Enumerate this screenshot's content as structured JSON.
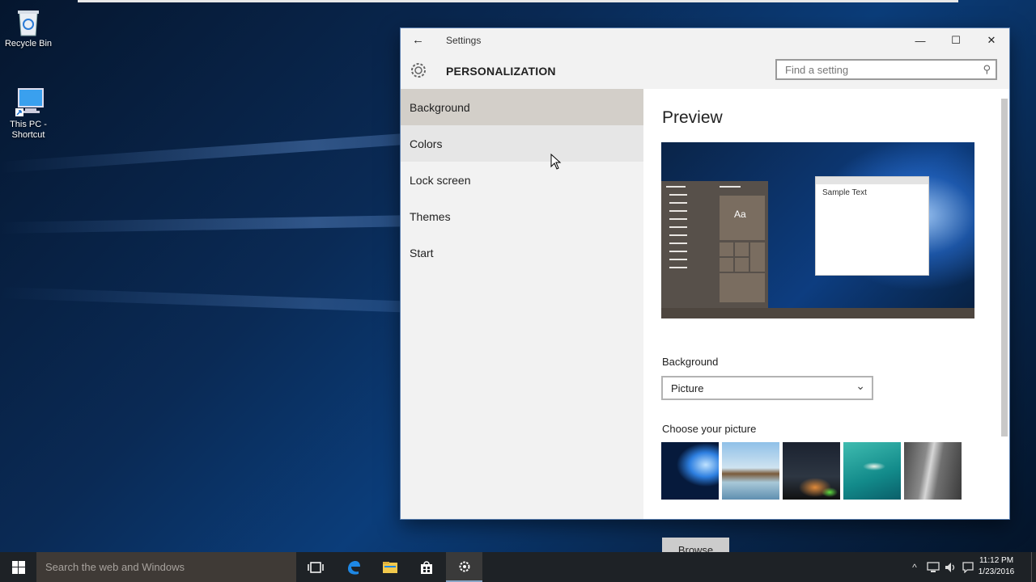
{
  "desktop": {
    "icons": [
      {
        "label_line1": "Recycle Bin",
        "label_line2": "",
        "icon": "recycle-bin-icon"
      },
      {
        "label_line1": "This PC -",
        "label_line2": "Shortcut",
        "icon": "computer-icon"
      }
    ]
  },
  "window": {
    "title": "Settings",
    "back_glyph": "←",
    "minimize_glyph": "—",
    "maximize_glyph": "☐",
    "close_glyph": "✕",
    "page_title": "PERSONALIZATION",
    "search_placeholder": "Find a setting",
    "search_icon_glyph": "⚲",
    "nav": [
      {
        "label": "Background",
        "state": "selected"
      },
      {
        "label": "Colors",
        "state": "hover"
      },
      {
        "label": "Lock screen",
        "state": "normal"
      },
      {
        "label": "Themes",
        "state": "normal"
      },
      {
        "label": "Start",
        "state": "normal"
      }
    ],
    "content": {
      "preview_heading": "Preview",
      "preview_tile_text": "Aa",
      "preview_sample_text": "Sample Text",
      "background_label": "Background",
      "background_value": "Picture",
      "dropdown_chevron": "⌄",
      "choose_label": "Choose your picture",
      "browse_label": "Browse",
      "pictures": [
        "windows-hero",
        "beach-rocks",
        "night-sky",
        "underwater-swimmer",
        "rock-cliff"
      ]
    }
  },
  "taskbar": {
    "search_placeholder": "Search the web and Windows",
    "clock_time": "11:12 PM",
    "clock_date": "1/23/2016",
    "tray_chevron": "^"
  },
  "colors": {
    "accent": "#57504a",
    "nav_selected": "#d3cfc9",
    "taskbar": "#1e2226"
  }
}
